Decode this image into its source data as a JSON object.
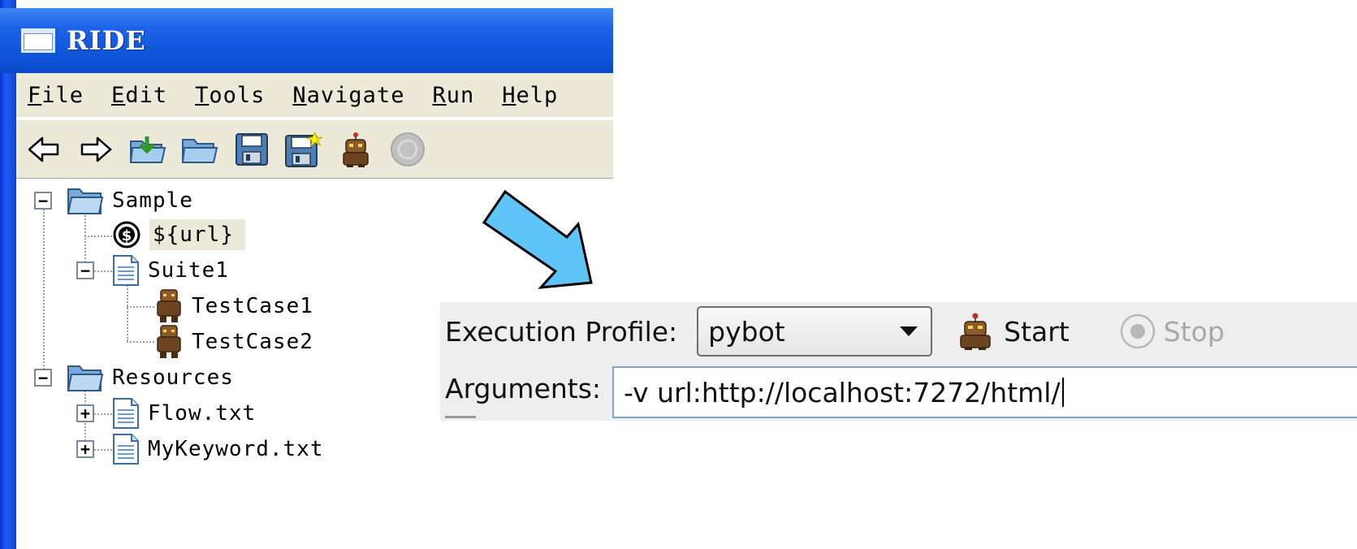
{
  "window": {
    "title": "RIDE"
  },
  "menu": [
    {
      "first": "F",
      "rest": "ile"
    },
    {
      "first": "E",
      "rest": "dit"
    },
    {
      "first": "T",
      "rest": "ools"
    },
    {
      "first": "N",
      "rest": "avigate"
    },
    {
      "first": "R",
      "rest": "un"
    },
    {
      "first": "H",
      "rest": "elp"
    }
  ],
  "toolbar": {
    "icons": [
      "back-arrow-icon",
      "forward-arrow-icon",
      "open-suite-icon",
      "open-folder-icon",
      "save-icon",
      "save-all-icon",
      "run-robot-icon",
      "stop-icon"
    ]
  },
  "tree": {
    "sample": "Sample",
    "url_var": "${url}",
    "suite1": "Suite1",
    "testcase1": "TestCase1",
    "testcase2": "TestCase2",
    "resources": "Resources",
    "flow": "Flow.txt",
    "mykeyword": "MyKeyword.txt",
    "expand_open": "−",
    "expand_closed": "+"
  },
  "execution": {
    "profile_label": "Execution Profile:",
    "profile_value": "pybot",
    "start_label": "Start",
    "stop_label": "Stop",
    "arguments_label": "Arguments:",
    "arguments_value": "-v url:http://localhost:7272/html/"
  },
  "colors": {
    "titlebar": "#0f55db",
    "chrome": "#ece9d8",
    "arrow": "#5fc4f8",
    "panel": "#eeeeee"
  }
}
